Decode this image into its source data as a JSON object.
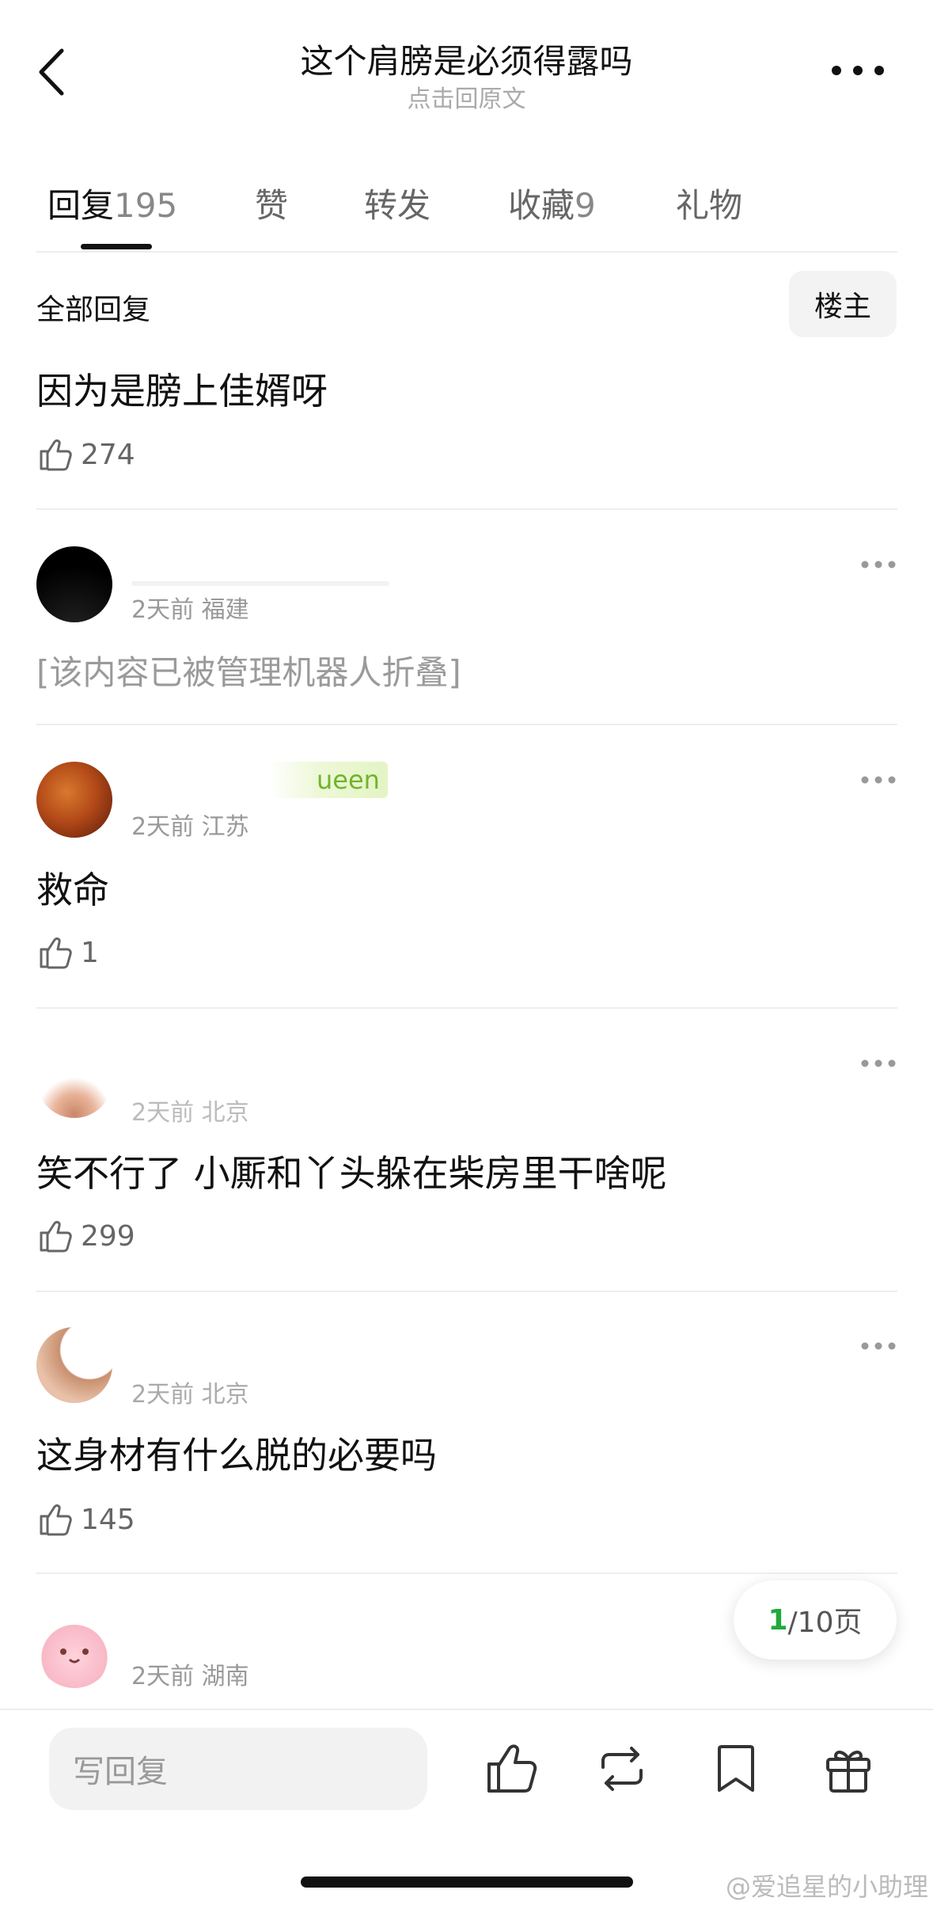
{
  "header": {
    "title": "这个肩膀是必须得露吗",
    "subtitle": "点击回原文"
  },
  "tabs": [
    {
      "label": "回复",
      "count": "195"
    },
    {
      "label": "赞",
      "count": ""
    },
    {
      "label": "转发",
      "count": ""
    },
    {
      "label": "收藏",
      "count": "9"
    },
    {
      "label": "礼物",
      "count": ""
    }
  ],
  "filter": {
    "all_replies": "全部回复",
    "op_button": "楼主"
  },
  "comments": [
    {
      "text": "因为是膀上佳婿呀",
      "likes": "274"
    },
    {
      "meta": "2天前 福建",
      "folded_text": "[该内容已被管理机器人折叠]"
    },
    {
      "meta": "2天前 江苏",
      "badge": "ueen",
      "text": "救命",
      "likes": "1"
    },
    {
      "meta": "2天前 北京",
      "text": "笑不行了 小厮和丫头躲在柴房里干啥呢",
      "likes": "299"
    },
    {
      "meta": "2天前 北京",
      "text": "这身材有什么脱的必要吗",
      "likes": "145"
    },
    {
      "meta": "2天前 湖南"
    }
  ],
  "pagination": {
    "current": "1",
    "total_label": "/10页"
  },
  "bottom_bar": {
    "reply_placeholder": "写回复"
  },
  "watermark": "@爱追星的小助理"
}
